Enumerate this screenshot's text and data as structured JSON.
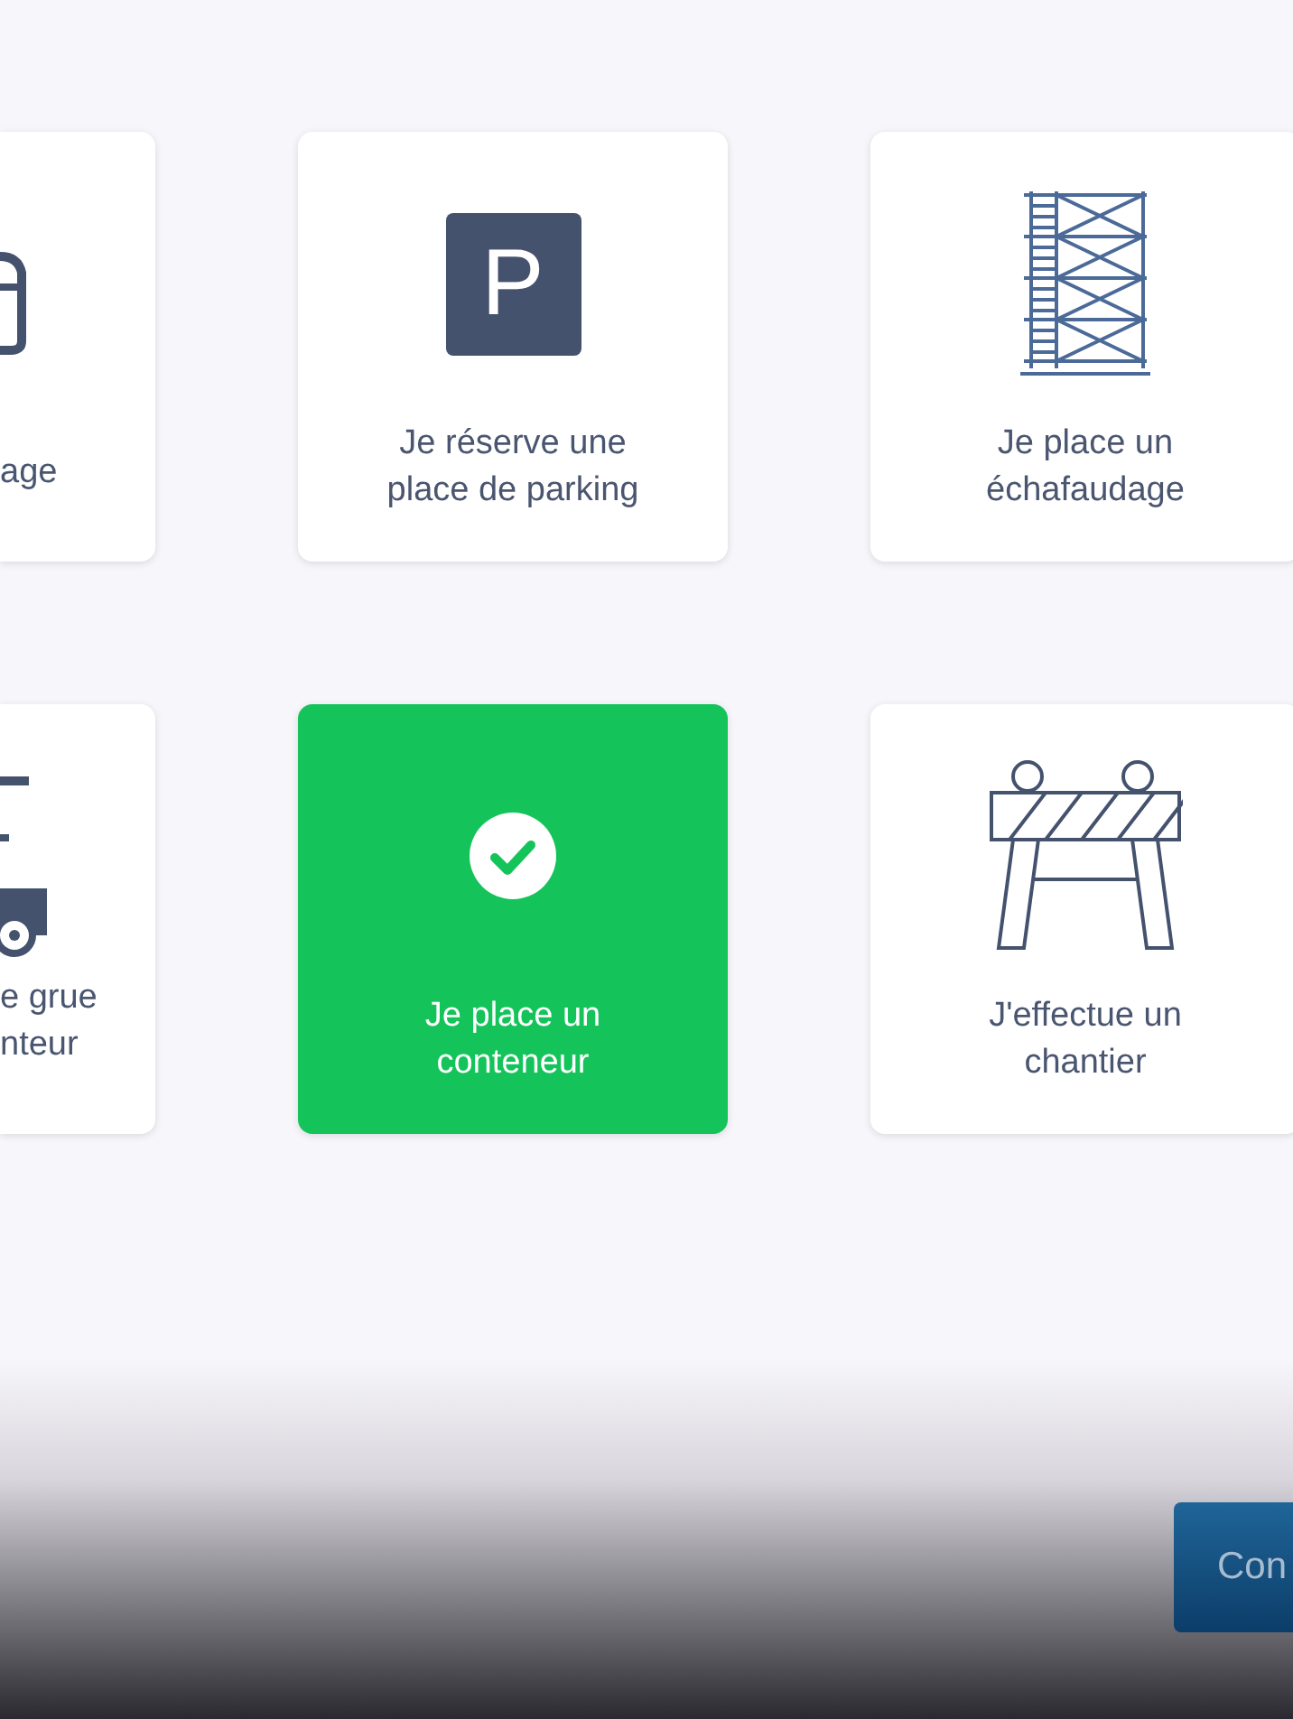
{
  "cards": [
    {
      "kind": "bag",
      "lines": [
        "age"
      ],
      "selected": false
    },
    {
      "kind": "parking",
      "sign": "P",
      "lines": [
        "Je réserve une",
        "place de parking"
      ],
      "selected": false
    },
    {
      "kind": "scaffold",
      "lines": [
        "Je place un",
        "échafaudage"
      ],
      "selected": false
    },
    {
      "kind": "crane-truck",
      "lines": [
        "e grue",
        "nteur"
      ],
      "selected": false
    },
    {
      "lines": [
        "Je place un",
        "conteneur"
      ],
      "selected": true
    },
    {
      "kind": "barrier",
      "lines": [
        "J'effectue un",
        "chantier"
      ],
      "selected": false
    }
  ],
  "continue_button": {
    "label": "Con"
  }
}
